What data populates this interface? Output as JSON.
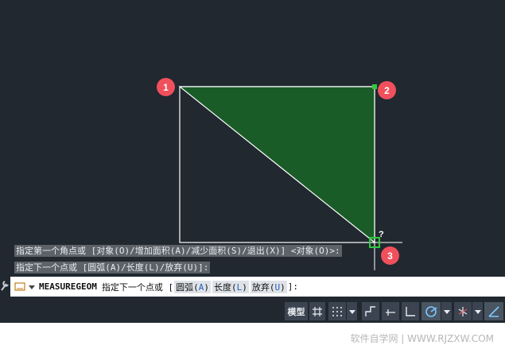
{
  "canvas": {
    "markers": [
      "1",
      "2",
      "3"
    ],
    "cursor_hint": "?",
    "colors": {
      "fill": "#1a5c28",
      "edge": "#ffffff",
      "crosshair": "#ffffff",
      "marker": "#f0505c"
    }
  },
  "history": [
    "指定第一个角点或 [对象(O)/增加面积(A)/减少面积(S)/退出(X)] <对象(O)>:",
    "指定下一个点或 [圆弧(A)/长度(L)/放弃(U)]:"
  ],
  "command_line": {
    "command": "MEASUREGEOM",
    "prompt": "指定下一个点或 [",
    "options": [
      {
        "pre": "圆弧(",
        "key": "A",
        "post": ")"
      },
      {
        "pre": "长度(",
        "key": "L",
        "post": ")"
      },
      {
        "pre": "放弃(",
        "key": "U",
        "post": ")"
      }
    ],
    "suffix": "]:"
  },
  "statusbar": {
    "model_label": "模型",
    "icons": [
      "grid-icon",
      "snap-dots-icon",
      "dropdown-arrow-icon",
      "infer-constraints-icon",
      "dynamic-input-icon",
      "ortho-icon",
      "polar-tracking-icon",
      "dropdown-arrow-icon",
      "isodraft-icon",
      "dropdown-arrow-icon",
      "osnap-tracking-icon"
    ]
  },
  "watermark": "软件自学网 | WWW.RJZXW.COM"
}
